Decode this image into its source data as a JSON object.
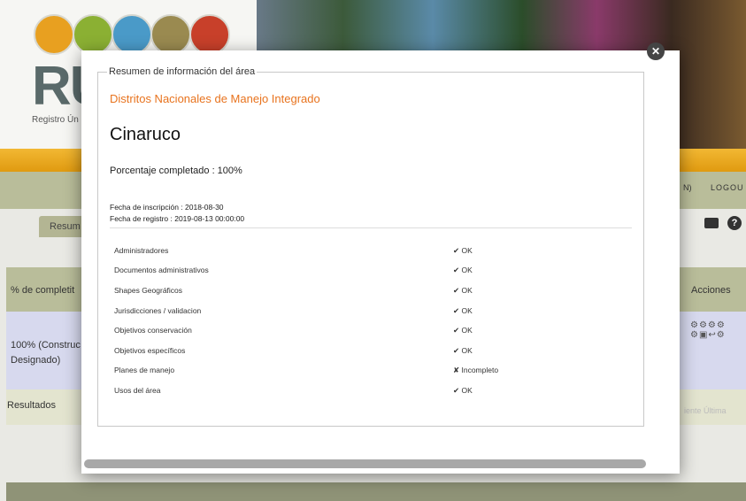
{
  "background": {
    "registry_text": "Registro Ún",
    "user_text": "N)",
    "logout": "LOGOU",
    "tab_resumen": "Resum",
    "col_completitud": "% de completit",
    "col_acciones": "Acciones",
    "row_line1": "100% (Construc",
    "row_line2": "Designado)",
    "actions_glyphs": "⚙⚙⚙⚙ ⚙▣↩⚙",
    "resultados": "Resultados",
    "pager": "iente  Última"
  },
  "modal": {
    "legend": "Resumen de información del área",
    "category": "Distritos Nacionales de Manejo Integrado",
    "area_name": "Cinaruco",
    "percent_label": "Porcentaje completado : 100%",
    "fecha_inscripcion": "Fecha de inscripción : 2018-08-30",
    "fecha_registro": "Fecha de registro : 2019-08-13 00:00:00",
    "items": [
      {
        "label": "Administradores",
        "status": "✔ OK"
      },
      {
        "label": "Documentos administrativos",
        "status": "✔ OK"
      },
      {
        "label": "Shapes Geográficos",
        "status": "✔ OK"
      },
      {
        "label": "Jurisdicciones / validacion",
        "status": "✔ OK"
      },
      {
        "label": "Objetivos conservación",
        "status": "✔ OK"
      },
      {
        "label": "Objetivos específicos",
        "status": "✔ OK"
      },
      {
        "label": "Planes de manejo",
        "status": "✘ Incompleto"
      },
      {
        "label": "Usos del área",
        "status": "✔ OK"
      }
    ]
  },
  "colors": {
    "accent": "#e8731e",
    "header_orange": "#f2b833",
    "olive": "#b9bd9a",
    "row_lavender": "#d7d9ee"
  },
  "icons": [
    "close-icon",
    "video-camera-icon",
    "help-icon"
  ]
}
